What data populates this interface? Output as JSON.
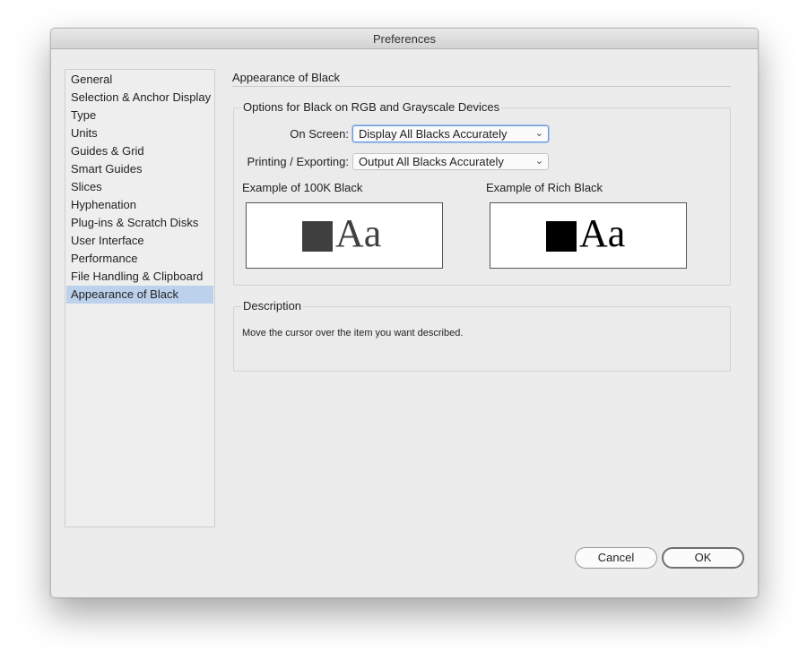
{
  "window": {
    "title": "Preferences"
  },
  "sidebar": {
    "items": [
      {
        "label": "General"
      },
      {
        "label": "Selection & Anchor Display"
      },
      {
        "label": "Type"
      },
      {
        "label": "Units"
      },
      {
        "label": "Guides & Grid"
      },
      {
        "label": "Smart Guides"
      },
      {
        "label": "Slices"
      },
      {
        "label": "Hyphenation"
      },
      {
        "label": "Plug-ins & Scratch Disks"
      },
      {
        "label": "User Interface"
      },
      {
        "label": "Performance"
      },
      {
        "label": "File Handling & Clipboard"
      },
      {
        "label": "Appearance of Black"
      }
    ],
    "selected": "Appearance of Black"
  },
  "main": {
    "title": "Appearance of Black",
    "options_group": {
      "label": "Options for Black on RGB and Grayscale Devices",
      "on_screen_label": "On Screen:",
      "on_screen_value": "Display All Blacks Accurately",
      "printing_label": "Printing / Exporting:",
      "printing_value": "Output All Blacks Accurately",
      "example_100k_label": "Example of 100K Black",
      "example_rich_label": "Example of Rich Black",
      "sample_text": "Aa",
      "color_100k": "#3f3f3f",
      "color_rich": "#000000"
    },
    "description": {
      "label": "Description",
      "text": "Move the cursor over the item you want described."
    }
  },
  "buttons": {
    "cancel": "Cancel",
    "ok": "OK"
  }
}
